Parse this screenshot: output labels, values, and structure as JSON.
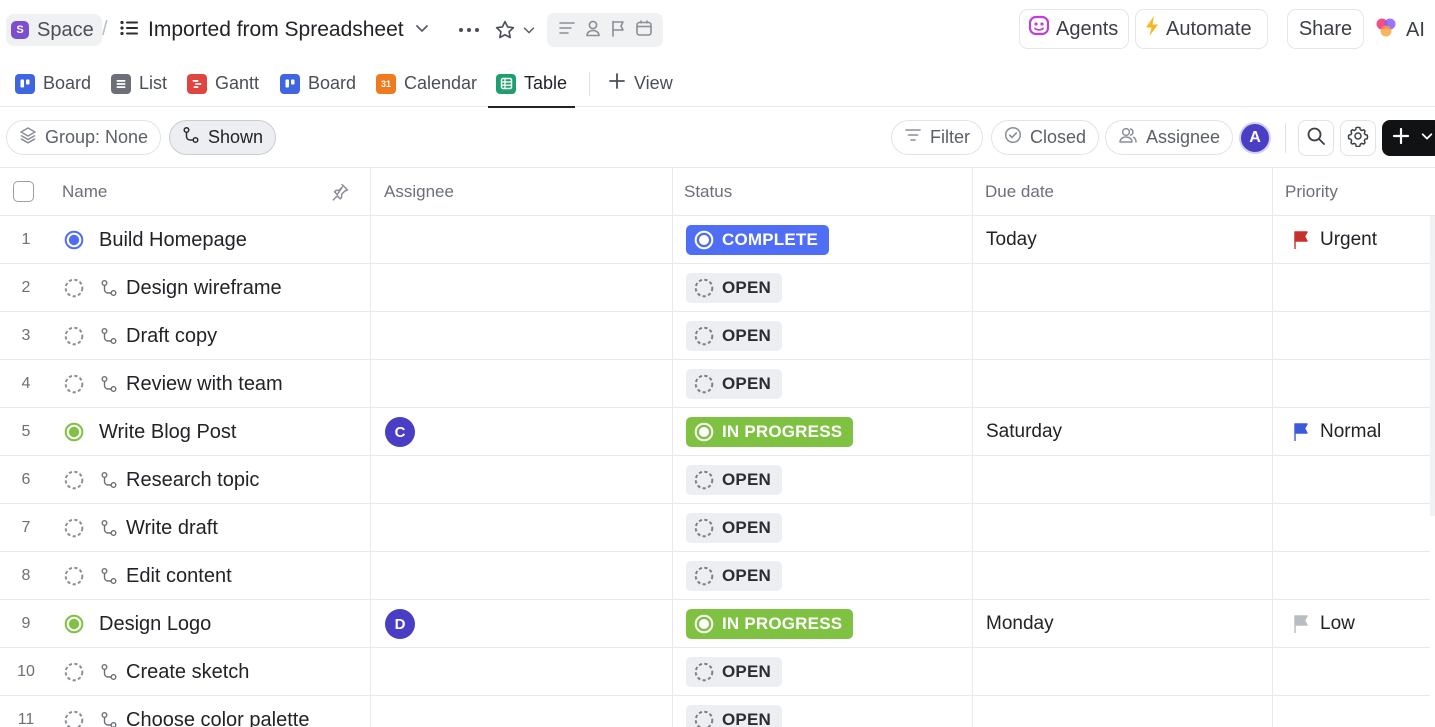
{
  "breadcrumb": {
    "space_initial": "S",
    "space_label": "Space",
    "separator": "/",
    "list_title": "Imported from Spreadsheet"
  },
  "header_actions": {
    "agents": "Agents",
    "automate": "Automate",
    "share": "Share",
    "ai": "AI"
  },
  "view_tabs": [
    {
      "label": "Board",
      "icon": "board-icon",
      "color": "#3f66e0"
    },
    {
      "label": "List",
      "icon": "list-icon",
      "color": "#6b7078"
    },
    {
      "label": "Gantt",
      "icon": "gantt-icon",
      "color": "#e0453f"
    },
    {
      "label": "Board",
      "icon": "board-icon",
      "color": "#3f66e0"
    },
    {
      "label": "Calendar",
      "icon": "calendar-icon",
      "color": "#f07a1e",
      "icon_text": "31"
    },
    {
      "label": "Table",
      "icon": "table-icon",
      "color": "#1f9e6e",
      "active": true
    }
  ],
  "add_view_label": "View",
  "toolbar": {
    "group_label": "Group: None",
    "shown_label": "Shown",
    "filter_label": "Filter",
    "closed_label": "Closed",
    "assignee_label": "Assignee",
    "user_initial": "A"
  },
  "table": {
    "columns": [
      "Name",
      "Assignee",
      "Status",
      "Due date",
      "Priority"
    ],
    "rows": [
      {
        "num": "1",
        "name": "Build Homepage",
        "subtask": false,
        "state": "complete",
        "assignee": "",
        "status": "COMPLETE",
        "due": "Today",
        "priority": "Urgent"
      },
      {
        "num": "2",
        "name": "Design wireframe",
        "subtask": true,
        "state": "open",
        "assignee": "",
        "status": "OPEN",
        "due": "",
        "priority": ""
      },
      {
        "num": "3",
        "name": "Draft copy",
        "subtask": true,
        "state": "open",
        "assignee": "",
        "status": "OPEN",
        "due": "",
        "priority": ""
      },
      {
        "num": "4",
        "name": "Review with team",
        "subtask": true,
        "state": "open",
        "assignee": "",
        "status": "OPEN",
        "due": "",
        "priority": ""
      },
      {
        "num": "5",
        "name": "Write Blog Post",
        "subtask": false,
        "state": "progress",
        "assignee": "C",
        "status": "IN PROGRESS",
        "due": "Saturday",
        "priority": "Normal"
      },
      {
        "num": "6",
        "name": "Research topic",
        "subtask": true,
        "state": "open",
        "assignee": "",
        "status": "OPEN",
        "due": "",
        "priority": ""
      },
      {
        "num": "7",
        "name": "Write draft",
        "subtask": true,
        "state": "open",
        "assignee": "",
        "status": "OPEN",
        "due": "",
        "priority": ""
      },
      {
        "num": "8",
        "name": "Edit content",
        "subtask": true,
        "state": "open",
        "assignee": "",
        "status": "OPEN",
        "due": "",
        "priority": ""
      },
      {
        "num": "9",
        "name": "Design Logo",
        "subtask": false,
        "state": "progress",
        "assignee": "D",
        "status": "IN PROGRESS",
        "due": "Monday",
        "priority": "Low"
      },
      {
        "num": "10",
        "name": "Create sketch",
        "subtask": true,
        "state": "open",
        "assignee": "",
        "status": "OPEN",
        "due": "",
        "priority": ""
      },
      {
        "num": "11",
        "name": "Choose color palette",
        "subtask": true,
        "state": "open",
        "assignee": "",
        "status": "OPEN",
        "due": "",
        "priority": ""
      }
    ]
  },
  "colors": {
    "complete": "#4f6ef5",
    "in_progress": "#7fc242",
    "open_bg": "#eceef1",
    "urgent_flag": "#c8312b",
    "normal_flag": "#3b5bdb",
    "low_flag": "#b8bcc3",
    "avatar": "#4a3fc4",
    "space_avatar": "#7b4fcf"
  }
}
